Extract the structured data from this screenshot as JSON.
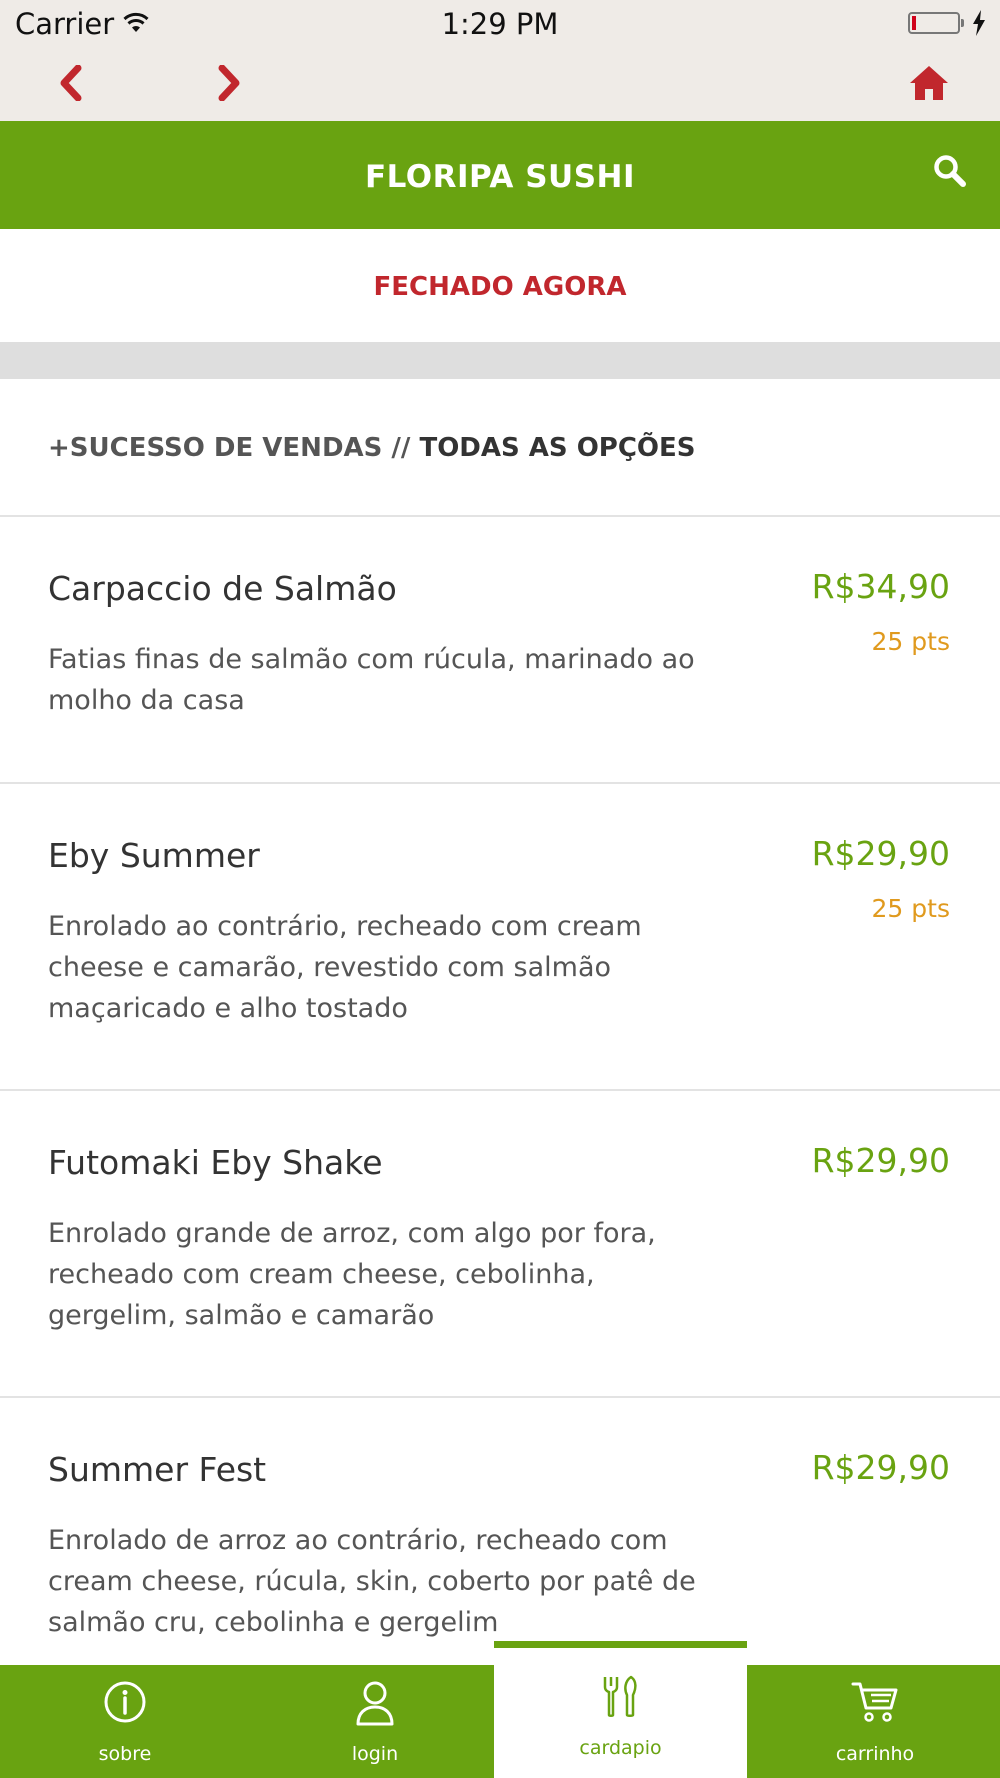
{
  "status_bar": {
    "carrier": "Carrier",
    "time": "1:29 PM",
    "icons": [
      "wifi-icon",
      "battery-icon",
      "charging-bolt-icon"
    ],
    "battery_level": 0.08
  },
  "nav": {
    "icons": [
      "back-chevron-icon",
      "forward-chevron-icon",
      "home-icon"
    ]
  },
  "header": {
    "title": "FLORIPA SUSHI",
    "search_icon": "search-icon"
  },
  "status_banner": {
    "text": "FECHADO AGORA"
  },
  "section": {
    "prefix": "+SUCESSO DE VENDAS // ",
    "title": "TODAS AS OPÇÕES"
  },
  "menu": {
    "items": [
      {
        "name": "Carpaccio de Salmão",
        "description": "Fatias finas de salmão com rúcula, marinado ao molho da casa",
        "price": "R$34,90",
        "points": "25 pts"
      },
      {
        "name": "Eby Summer",
        "description": "Enrolado ao contrário, recheado com cream cheese e camarão, revestido com salmão maçaricado e alho tostado",
        "price": "R$29,90",
        "points": "25 pts"
      },
      {
        "name": "Futomaki Eby Shake",
        "description": "Enrolado grande de arroz, com algo por fora, recheado com cream cheese, cebolinha, gergelim, salmão e camarão",
        "price": "R$29,90",
        "points": ""
      },
      {
        "name": "Summer Fest",
        "description": "Enrolado de arroz ao contrário, recheado com cream cheese, rúcula, skin, coberto por patê de salmão cru, cebolinha e gergelim",
        "price": "R$29,90",
        "points": ""
      }
    ]
  },
  "tabs": [
    {
      "label": "sobre",
      "icon": "info-icon"
    },
    {
      "label": "login",
      "icon": "user-icon"
    },
    {
      "label": "cardapio",
      "icon": "utensils-icon",
      "active": true
    },
    {
      "label": "carrinho",
      "icon": "cart-icon"
    }
  ],
  "colors": {
    "brand_green": "#69a311",
    "closed_red": "#c1272d",
    "points_orange": "#e09a1e",
    "nav_red": "#c1272d"
  }
}
